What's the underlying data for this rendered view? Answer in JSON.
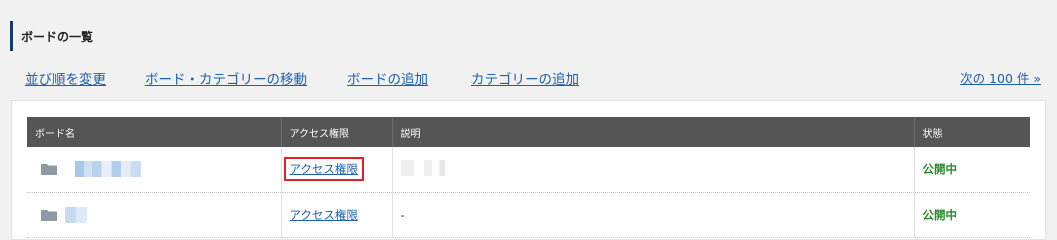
{
  "section": {
    "title": "ボードの一覧"
  },
  "actions": {
    "reorder": "並び順を変更",
    "move": "ボード・カテゴリーの移動",
    "add_board": "ボードの追加",
    "add_category": "カテゴリーの追加",
    "next_page": "次の 100 件 »"
  },
  "table": {
    "headers": [
      "ボード名",
      "アクセス権限",
      "説明",
      "状態"
    ],
    "rows": [
      {
        "permission": "アクセス権限",
        "description": "",
        "status": "公開中"
      },
      {
        "permission": "アクセス権限",
        "description": "-",
        "status": "公開中"
      }
    ]
  },
  "colors": {
    "link": "#1f5fa8",
    "header_bg": "#555555",
    "status_public": "#2b8a2e",
    "highlight": "#e0202a",
    "title_bar": "#1a3a6b"
  },
  "icons": {
    "row_icon": "folder-icon"
  }
}
